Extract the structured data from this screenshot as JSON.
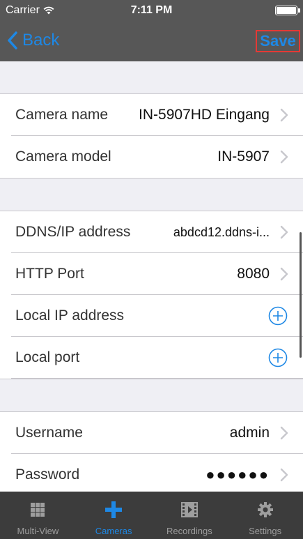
{
  "status_bar": {
    "carrier": "Carrier",
    "time": "7:11 PM"
  },
  "nav": {
    "back_label": "Back",
    "save_label": "Save"
  },
  "sections": [
    {
      "rows": [
        {
          "label": "Camera name",
          "value": "IN-5907HD Eingang",
          "accessory": "chevron"
        },
        {
          "label": "Camera model",
          "value": "IN-5907",
          "accessory": "chevron"
        }
      ]
    },
    {
      "rows": [
        {
          "label": "DDNS/IP address",
          "value": "abdcd12.ddns-i...",
          "accessory": "chevron"
        },
        {
          "label": "HTTP Port",
          "value": "8080",
          "accessory": "chevron"
        },
        {
          "label": "Local IP address",
          "value": "",
          "accessory": "plus"
        },
        {
          "label": "Local port",
          "value": "",
          "accessory": "plus"
        }
      ]
    },
    {
      "rows": [
        {
          "label": "Username",
          "value": "admin",
          "accessory": "chevron"
        },
        {
          "label": "Password",
          "value": "●●●●●●",
          "accessory": "chevron"
        }
      ]
    }
  ],
  "tabs": [
    {
      "label": "Multi-View",
      "icon": "grid-icon",
      "active": false
    },
    {
      "label": "Cameras",
      "icon": "plus-icon",
      "active": true
    },
    {
      "label": "Recordings",
      "icon": "film-icon",
      "active": false
    },
    {
      "label": "Settings",
      "icon": "gear-icon",
      "active": false
    }
  ],
  "colors": {
    "accent": "#1e88e5",
    "nav_background": "#575757",
    "tab_background": "#3c3c3c",
    "save_highlight": "#e53935"
  }
}
